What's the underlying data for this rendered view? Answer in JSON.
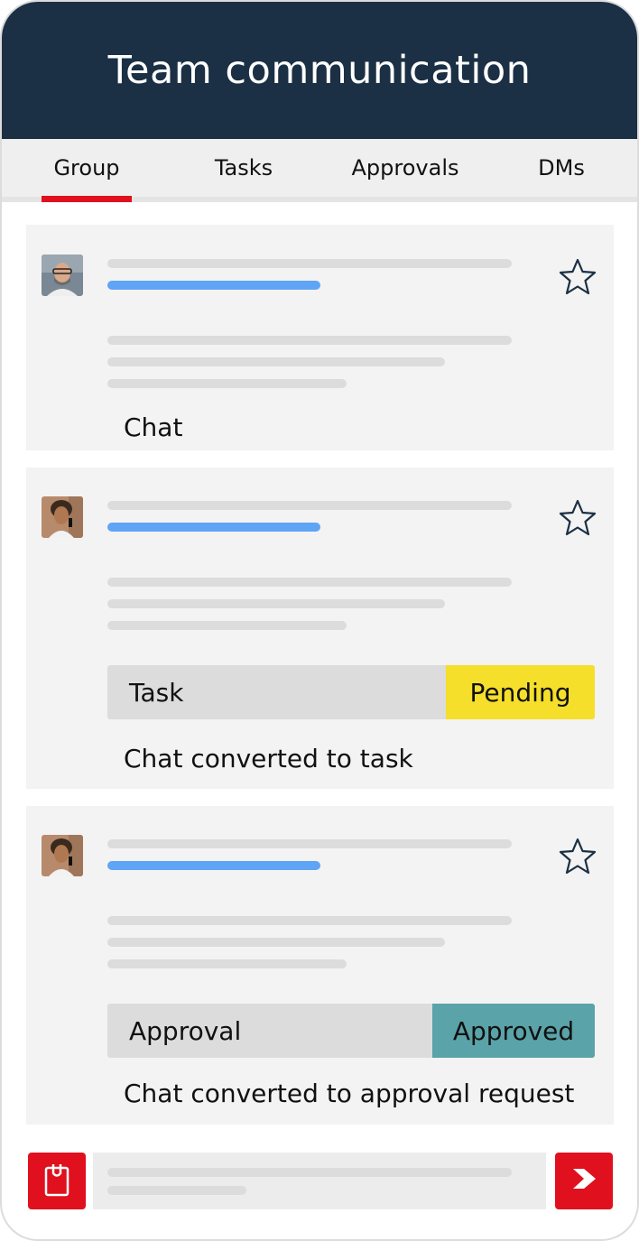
{
  "header": {
    "title": "Team communication"
  },
  "tabs": [
    {
      "label": "Group",
      "active": true
    },
    {
      "label": "Tasks",
      "active": false
    },
    {
      "label": "Approvals",
      "active": false
    },
    {
      "label": "DMs",
      "active": false
    }
  ],
  "cards": [
    {
      "caption": "Chat",
      "starred": false
    },
    {
      "caption": "Chat converted to task",
      "starred": false,
      "tag": {
        "label": "Task",
        "status": "Pending",
        "status_color": "#f5df2a"
      }
    },
    {
      "caption": "Chat converted to approval request",
      "starred": false,
      "tag": {
        "label": "Approval",
        "status": "Approved",
        "status_color": "#5aa3a8"
      }
    }
  ],
  "composer": {
    "attach_icon": "clipboard-icon",
    "send_icon": "send-chevron-icon"
  },
  "colors": {
    "header_bg": "#1b3044",
    "accent_red": "#e0101e",
    "link_blue": "#5fa4f5"
  }
}
